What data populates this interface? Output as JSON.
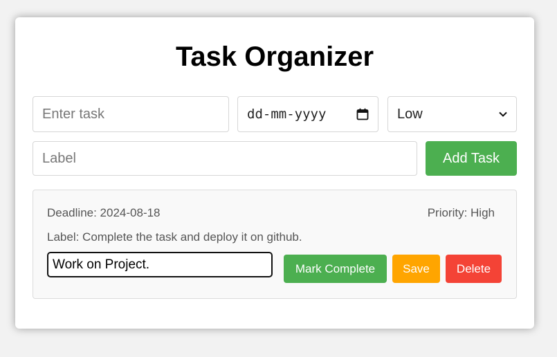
{
  "page": {
    "title": "Task Organizer"
  },
  "form": {
    "task_placeholder": "Enter task",
    "date_placeholder": "dd-mm-yyyy",
    "priority_selected": "Low",
    "label_placeholder": "Label",
    "add_button": "Add Task"
  },
  "task": {
    "deadline": "Deadline: 2024-08-18",
    "priority": "Priority: High",
    "label": "Label: Complete the task and deploy it on github.",
    "text_value": "Work on Project.",
    "complete_button": "Mark Complete",
    "save_button": "Save",
    "delete_button": "Delete"
  },
  "colors": {
    "green": "#4caf50",
    "orange": "#ffa500",
    "red": "#f44336"
  },
  "icons": {
    "date": "calendar-icon",
    "select": "chevron-down-icon"
  }
}
